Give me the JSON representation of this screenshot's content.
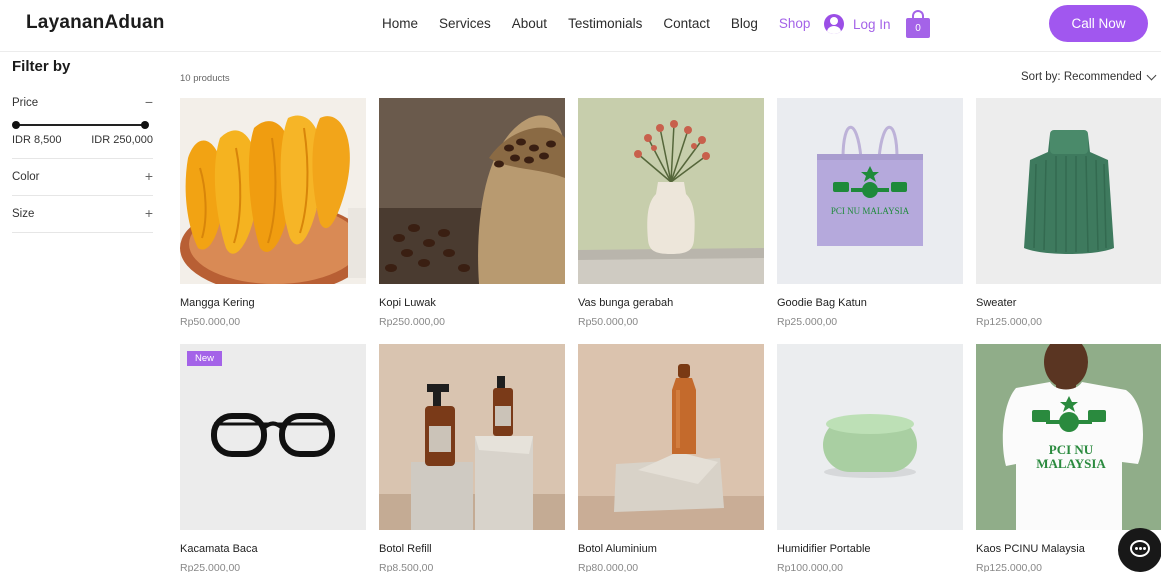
{
  "header": {
    "logo": "LayananAduan",
    "nav": [
      "Home",
      "Services",
      "About",
      "Testimonials",
      "Contact",
      "Blog",
      "Shop"
    ],
    "active_nav": "Shop",
    "login_label": "Log In",
    "cart_count": "0",
    "call_label": "Call Now"
  },
  "sidebar": {
    "title": "Filter by",
    "price_label": "Price",
    "price_min": "IDR 8,500",
    "price_max": "IDR 250,000",
    "color_label": "Color",
    "size_label": "Size"
  },
  "main": {
    "count": "10 products",
    "sort_label": "Sort by: Recommended"
  },
  "products": [
    {
      "name": "Mangga Kering",
      "price": "Rp50.000,00"
    },
    {
      "name": "Kopi Luwak",
      "price": "Rp250.000,00"
    },
    {
      "name": "Vas bunga gerabah",
      "price": "Rp50.000,00"
    },
    {
      "name": "Goodie Bag Katun",
      "price": "Rp25.000,00"
    },
    {
      "name": "Sweater",
      "price": "Rp125.000,00"
    },
    {
      "name": "Kacamata Baca",
      "price": "Rp25.000,00",
      "badge": "New"
    },
    {
      "name": "Botol Refill",
      "price": "Rp8.500,00"
    },
    {
      "name": "Botol Aluminium",
      "price": "Rp80.000,00"
    },
    {
      "name": "Humidifier Portable",
      "price": "Rp100.000,00"
    },
    {
      "name": "Kaos PCINU Malaysia",
      "price": "Rp125.000,00"
    }
  ],
  "print_text": {
    "bag": "PCI NU MALAYSIA",
    "shirt_line1": "PCI NU",
    "shirt_line2": "MALAYSIA"
  },
  "colors": {
    "accent": "#a463e8",
    "button": "#a157ef"
  }
}
